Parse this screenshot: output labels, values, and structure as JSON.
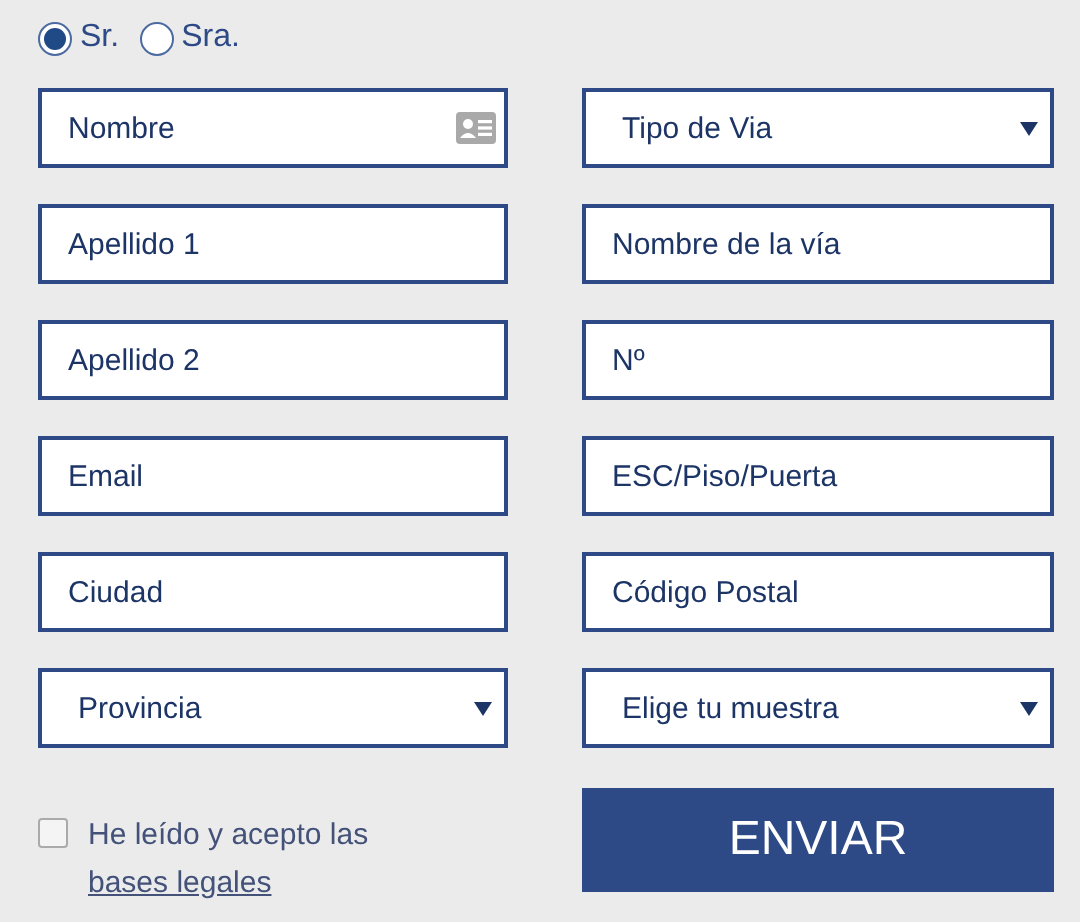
{
  "salutation": [
    {
      "label": "Sr.",
      "selected": true
    },
    {
      "label": "Sra.",
      "selected": false
    }
  ],
  "fields": [
    {
      "kind": "card",
      "placeholder": "Nombre"
    },
    {
      "kind": "select",
      "value": "Tipo de Via"
    },
    {
      "kind": "text",
      "placeholder": "Apellido 1"
    },
    {
      "kind": "text",
      "placeholder": "Nombre de la vía"
    },
    {
      "kind": "text",
      "placeholder": "Apellido 2"
    },
    {
      "kind": "text",
      "placeholder": "Nº"
    },
    {
      "kind": "text",
      "placeholder": "Email"
    },
    {
      "kind": "text",
      "placeholder": "ESC/Piso/Puerta"
    },
    {
      "kind": "text",
      "placeholder": "Ciudad"
    },
    {
      "kind": "text",
      "placeholder": "Código Postal"
    },
    {
      "kind": "select",
      "value": "Provincia"
    },
    {
      "kind": "select",
      "value": "Elige tu muestra"
    }
  ],
  "consent": {
    "checked": false,
    "text": "He leído y acepto las",
    "link": "bases legales"
  },
  "submit": "ENVIAR"
}
